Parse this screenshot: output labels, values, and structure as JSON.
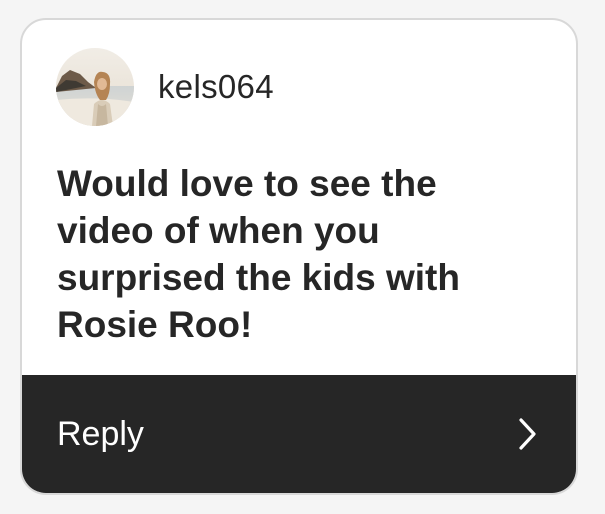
{
  "comment": {
    "username": "kels064",
    "text": "Would love to see the video of when you surprised the kids with Rosie Roo!",
    "avatar_icon": "profile-photo"
  },
  "reply": {
    "label": "Reply",
    "icon": "chevron-right-icon"
  },
  "colors": {
    "card_background": "#ffffff",
    "text": "#262626",
    "reply_bar": "#262626",
    "reply_text": "#ffffff",
    "border": "#d8d8d8"
  }
}
